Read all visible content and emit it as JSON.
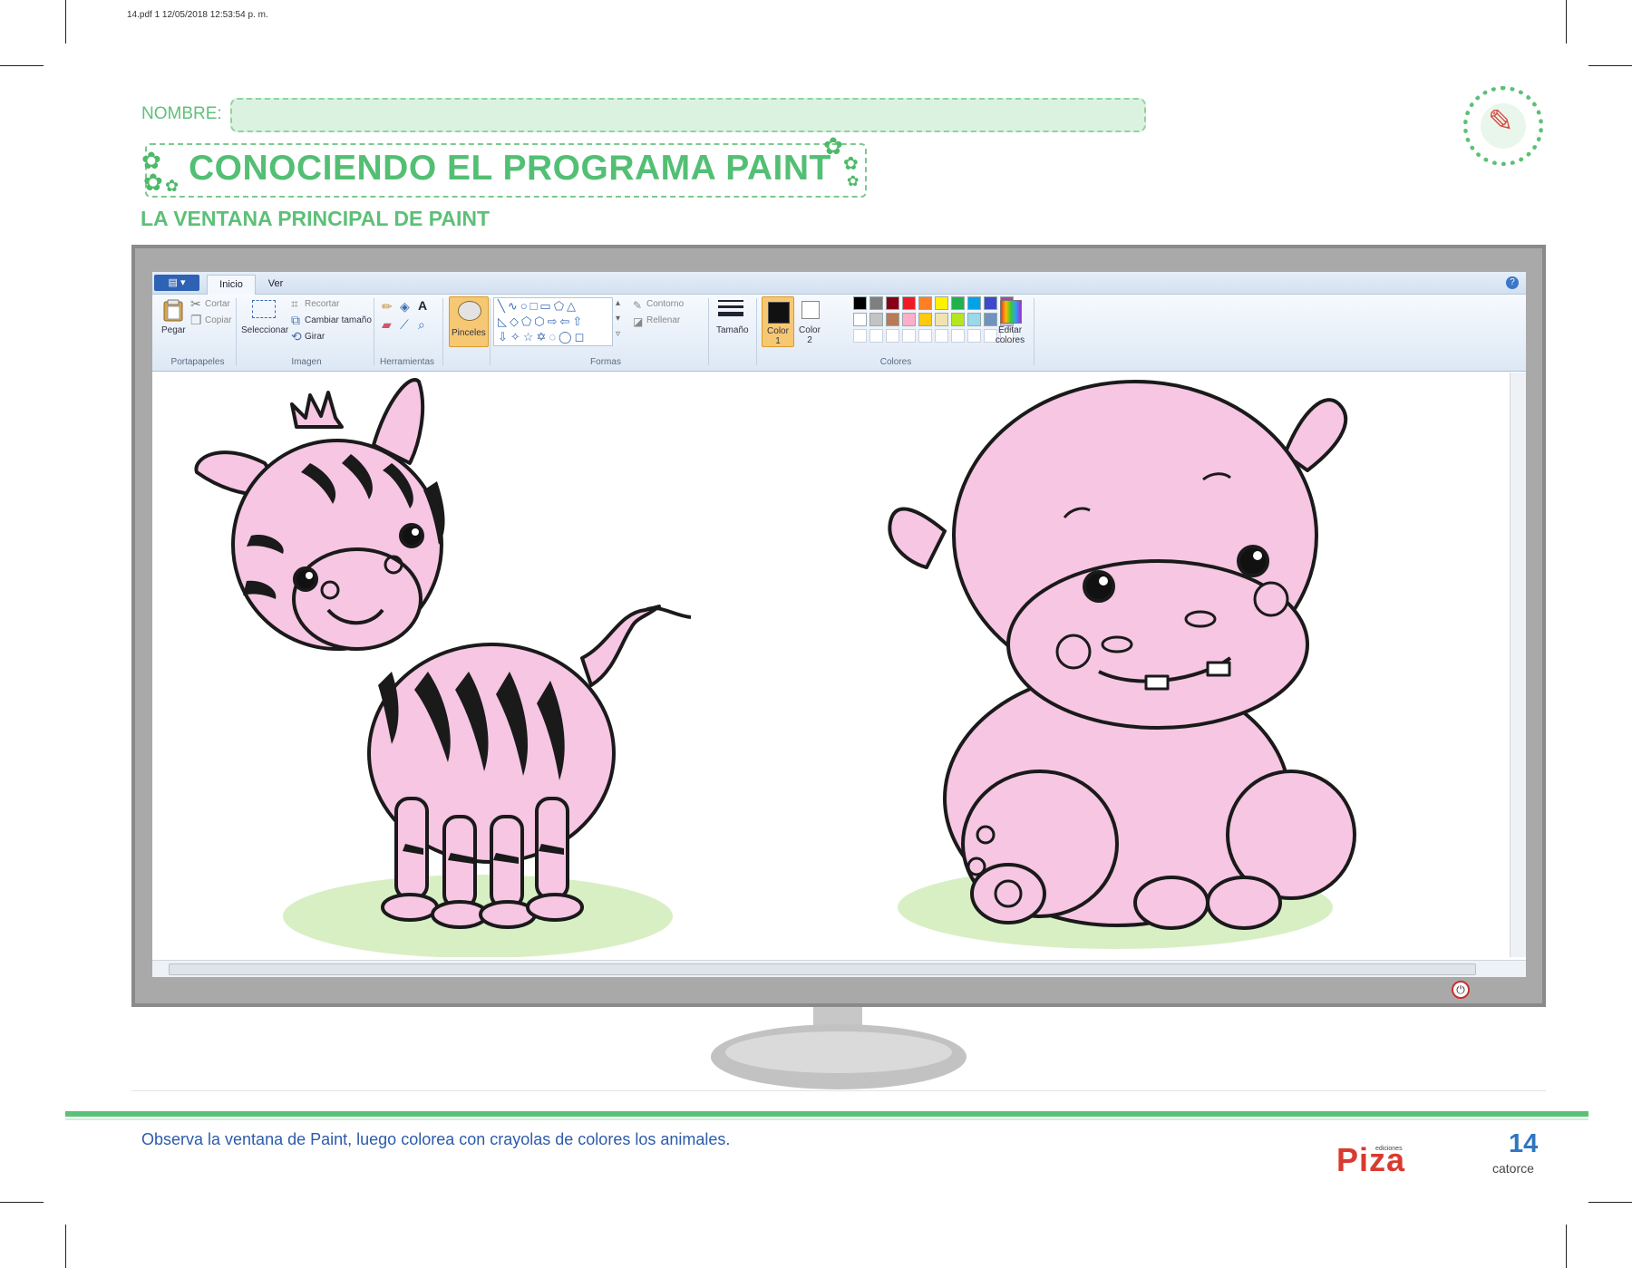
{
  "file_meta": "14.pdf   1   12/05/2018   12:53:54 p. m.",
  "header": {
    "name_label": "NOMBRE:",
    "title": "CONOCIENDO EL PROGRAMA PAINT",
    "subtitle": "LA VENTANA PRINCIPAL DE PAINT"
  },
  "paint": {
    "tabs": [
      "Inicio",
      "Ver"
    ],
    "clipboard": {
      "paste": "Pegar",
      "cut": "Cortar",
      "copy": "Copiar",
      "group": "Portapapeles"
    },
    "image": {
      "select": "Seleccionar",
      "crop": "Recortar",
      "resize": "Cambiar tamaño",
      "rotate": "Girar",
      "group": "Imagen"
    },
    "tools": {
      "group": "Herramientas"
    },
    "brushes": "Pinceles",
    "shapes": {
      "outline": "Contorno",
      "fill": "Rellenar",
      "group": "Formas"
    },
    "size": "Tamaño",
    "color1": "Color 1",
    "color2": "Color 2",
    "colors": {
      "edit": "Editar colores",
      "group": "Colores",
      "palette_row1": [
        "#000000",
        "#7f7f7f",
        "#880015",
        "#ed1c24",
        "#ff7f27",
        "#fff200",
        "#22b14c",
        "#00a2e8",
        "#3f48cc",
        "#a349a4"
      ],
      "palette_row2": [
        "#ffffff",
        "#c3c3c3",
        "#b97a57",
        "#ffaec9",
        "#ffc90e",
        "#efe4b0",
        "#b5e61d",
        "#99d9ea",
        "#7092be",
        "#c8bfe7"
      ]
    },
    "canvas_subjects": [
      "zebra",
      "hippo"
    ]
  },
  "footer": {
    "instruction": "Observa la ventana de Paint, luego colorea con crayolas de colores los animales.",
    "brand_small": "ediciones",
    "brand": "Piza",
    "page_number": "14",
    "page_word": "catorce"
  },
  "colors": {
    "green_accent": "#5cc077",
    "animal_pink": "#f6c6e3",
    "ground_green": "#d8efc4",
    "instruction_blue": "#2d5bab",
    "brand_red": "#d93a2f"
  }
}
